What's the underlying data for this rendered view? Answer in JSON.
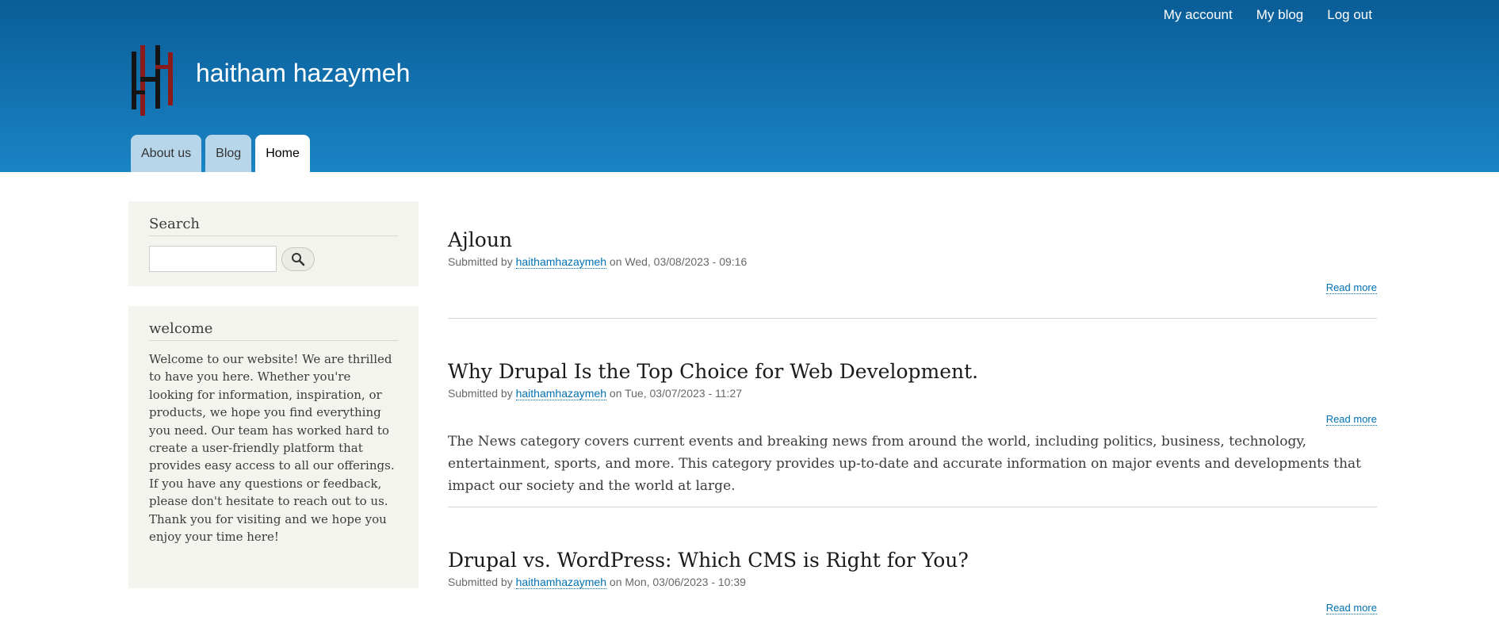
{
  "header": {
    "site_name": "haitham hazaymeh",
    "secondary_menu": [
      "My account",
      "My blog",
      "Log out"
    ],
    "tabs": [
      {
        "label": "About us",
        "active": false
      },
      {
        "label": "Blog",
        "active": false
      },
      {
        "label": "Home",
        "active": true
      }
    ],
    "colors": {
      "header_top": "#0a5d97",
      "header_bottom": "#1a84c5",
      "logo_dark": "#141414",
      "logo_red": "#8b1a1a"
    }
  },
  "sidebar": {
    "search": {
      "title": "Search",
      "input_value": "",
      "button_icon": "search-icon"
    },
    "welcome": {
      "title": "welcome",
      "body": "Welcome to our website! We are thrilled to have you here. Whether you're looking for information, inspiration, or products, we hope you find everything you need. Our team has worked hard to create a user-friendly platform that provides easy access to all our offerings. If you have any questions or feedback, please don't hesitate to reach out to us. Thank you for visiting and we hope you enjoy your time here!"
    }
  },
  "articles": [
    {
      "title": "Ajloun",
      "submitted_prefix": "Submitted by",
      "author": "haithamhazaymeh",
      "date": "on Wed, 03/08/2023 - 09:16",
      "read_more": "Read more",
      "teaser": ""
    },
    {
      "title": "Why Drupal Is the Top Choice for Web Development.",
      "submitted_prefix": "Submitted by",
      "author": "haithamhazaymeh",
      "date": "on Tue, 03/07/2023 - 11:27",
      "read_more": "Read more",
      "teaser": "The News category covers current events and breaking news from around the world, including politics, business, technology, entertainment, sports, and more. This category provides up-to-date and accurate information on major events and developments that impact our society and the world at large."
    },
    {
      "title": "Drupal vs. WordPress: Which CMS is Right for You?",
      "submitted_prefix": "Submitted by",
      "author": "haithamhazaymeh",
      "date": "on Mon, 03/06/2023 - 10:39",
      "read_more": "Read more",
      "teaser": ""
    }
  ]
}
